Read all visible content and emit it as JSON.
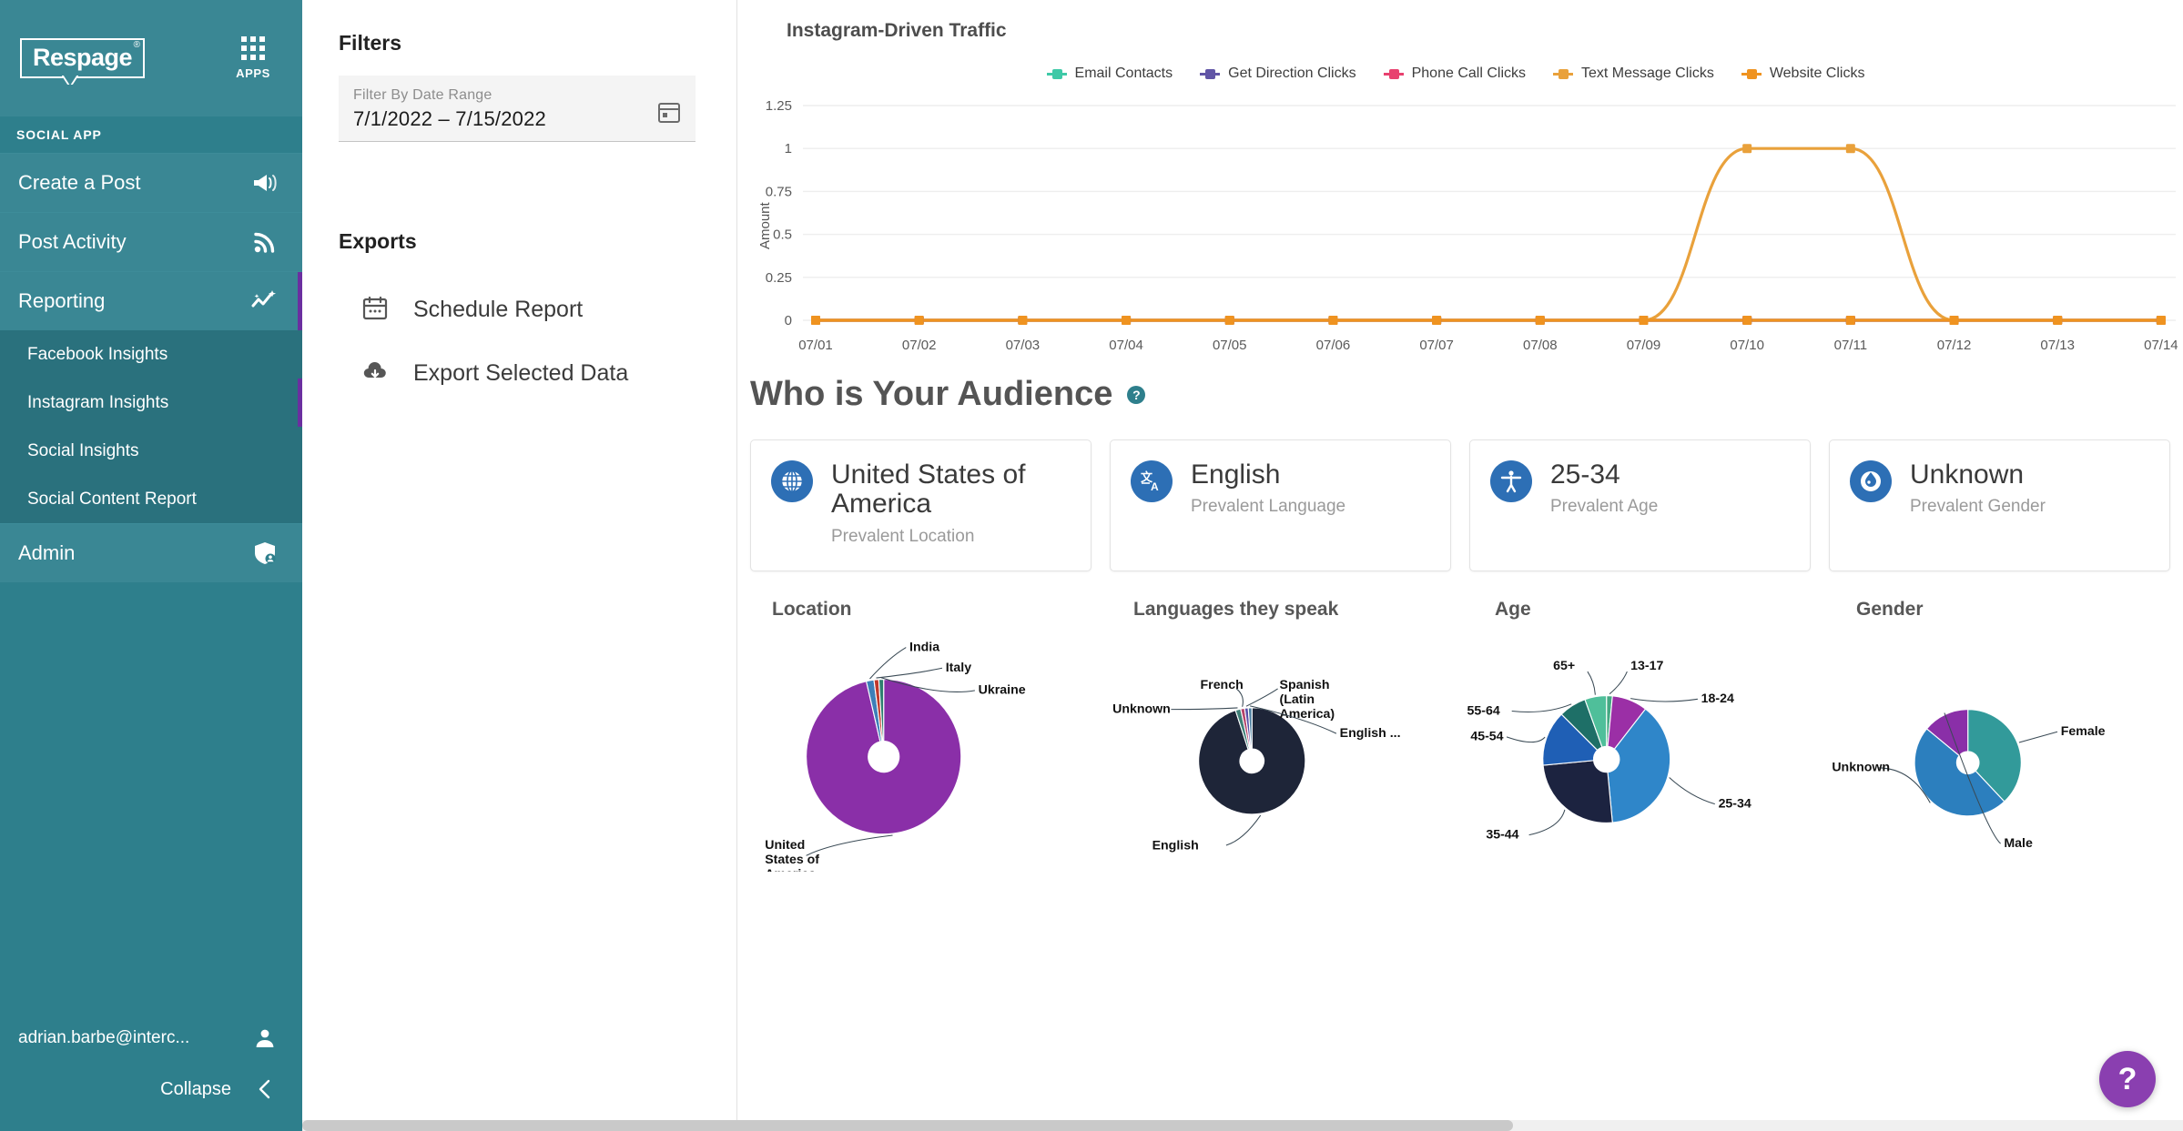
{
  "sidebar": {
    "logo": "Respage",
    "logo_registered": "®",
    "apps_label": "APPS",
    "section_label": "SOCIAL APP",
    "items": [
      {
        "label": "Create a Post",
        "icon": "megaphone-icon"
      },
      {
        "label": "Post Activity",
        "icon": "rss-icon"
      },
      {
        "label": "Reporting",
        "icon": "analytics-icon"
      }
    ],
    "sub_items": [
      {
        "label": "Facebook Insights"
      },
      {
        "label": "Instagram Insights"
      },
      {
        "label": "Social Insights"
      },
      {
        "label": "Social Content Report"
      }
    ],
    "admin": {
      "label": "Admin",
      "icon": "admin-shield-icon"
    },
    "user_email": "adrian.barbe@interc...",
    "collapse_label": "Collapse",
    "accent_color": "#6b2fa0",
    "background_color": "#2e7f8c"
  },
  "filters": {
    "title": "Filters",
    "date_field_label": "Filter By Date Range",
    "date_field_value": "7/1/2022   – 7/15/2022",
    "exports_title": "Exports",
    "export_items": [
      {
        "label": "Schedule Report",
        "icon": "calendar-icon"
      },
      {
        "label": "Export Selected Data",
        "icon": "cloud-download-icon"
      }
    ]
  },
  "main": {
    "audience_title": "Who is Your Audience",
    "help_glyph": "?",
    "fab_glyph": "?",
    "cards": [
      {
        "value": "United States of America",
        "sub": "Prevalent Location",
        "icon": "globe-icon"
      },
      {
        "value": "English",
        "sub": "Prevalent Language",
        "icon": "translate-icon"
      },
      {
        "value": "25-34",
        "sub": "Prevalent Age",
        "icon": "accessibility-icon"
      },
      {
        "value": "Unknown",
        "sub": "Prevalent Gender",
        "icon": "gender-icon"
      }
    ]
  },
  "chart_data": [
    {
      "type": "line",
      "title": "Instagram-Driven Traffic",
      "xlabel": "",
      "ylabel": "Amount",
      "ylim": [
        0,
        1.25
      ],
      "yticks": [
        0,
        0.25,
        0.5,
        0.75,
        1,
        1.25
      ],
      "ytick_labels": [
        "0",
        "0.25",
        "0.5",
        "0.75",
        "1",
        "1.25"
      ],
      "grid": true,
      "legend_position": "top-center",
      "x": [
        "07/01",
        "07/02",
        "07/03",
        "07/04",
        "07/05",
        "07/06",
        "07/07",
        "07/08",
        "07/09",
        "07/10",
        "07/11",
        "07/12",
        "07/13",
        "07/14"
      ],
      "series": [
        {
          "name": "Email Contacts",
          "color": "#3ec9a7",
          "values": [
            0,
            0,
            0,
            0,
            0,
            0,
            0,
            0,
            0,
            0,
            0,
            0,
            0,
            0
          ]
        },
        {
          "name": "Get Direction Clicks",
          "color": "#6155a6",
          "values": [
            0,
            0,
            0,
            0,
            0,
            0,
            0,
            0,
            0,
            0,
            0,
            0,
            0,
            0
          ]
        },
        {
          "name": "Phone Call Clicks",
          "color": "#e8416f",
          "values": [
            0,
            0,
            0,
            0,
            0,
            0,
            0,
            0,
            0,
            0,
            0,
            0,
            0,
            0
          ]
        },
        {
          "name": "Text Message Clicks",
          "color": "#e9a13b",
          "values": [
            0,
            0,
            0,
            0,
            0,
            0,
            0,
            0,
            0,
            1,
            1,
            0,
            0,
            0
          ]
        },
        {
          "name": "Website Clicks",
          "color": "#ef9320",
          "values": [
            0,
            0,
            0,
            0,
            0,
            0,
            0,
            0,
            0,
            0,
            0,
            0,
            0,
            0
          ]
        }
      ]
    },
    {
      "type": "pie",
      "title": "Location",
      "labels": [
        "United States of America",
        "India",
        "Italy",
        "Ukraine"
      ],
      "values": [
        96.4,
        1.6,
        1.0,
        1.0
      ],
      "colors": [
        "#8a2fa8",
        "#3d7fb8",
        "#c0392b",
        "#2f7f6f"
      ]
    },
    {
      "type": "pie",
      "title": "Languages they speak",
      "labels": [
        "English",
        "Unknown",
        "French",
        "Spanish (Latin America)",
        "English ..."
      ],
      "values": [
        95.0,
        1.6,
        1.2,
        1.1,
        1.1
      ],
      "colors": [
        "#1e2538",
        "#3f7f78",
        "#b5436a",
        "#5a4fa8",
        "#4b7fa0"
      ]
    },
    {
      "type": "pie",
      "title": "Age",
      "labels": [
        "13-17",
        "18-24",
        "25-34",
        "35-44",
        "45-54",
        "55-64",
        "65+"
      ],
      "values": [
        1.5,
        9.0,
        38.0,
        25.0,
        14.0,
        7.0,
        5.5
      ],
      "colors": [
        "#45a883",
        "#9b2fa6",
        "#2f86c9",
        "#1c2340",
        "#1f5fb5",
        "#1e6f67",
        "#4fbf9a"
      ]
    },
    {
      "type": "pie",
      "title": "Gender",
      "labels": [
        "Female",
        "Unknown",
        "Male"
      ],
      "values": [
        38.0,
        48.0,
        14.0
      ],
      "colors": [
        "#329a9a",
        "#2c7fbe",
        "#8a2fa8"
      ]
    }
  ]
}
